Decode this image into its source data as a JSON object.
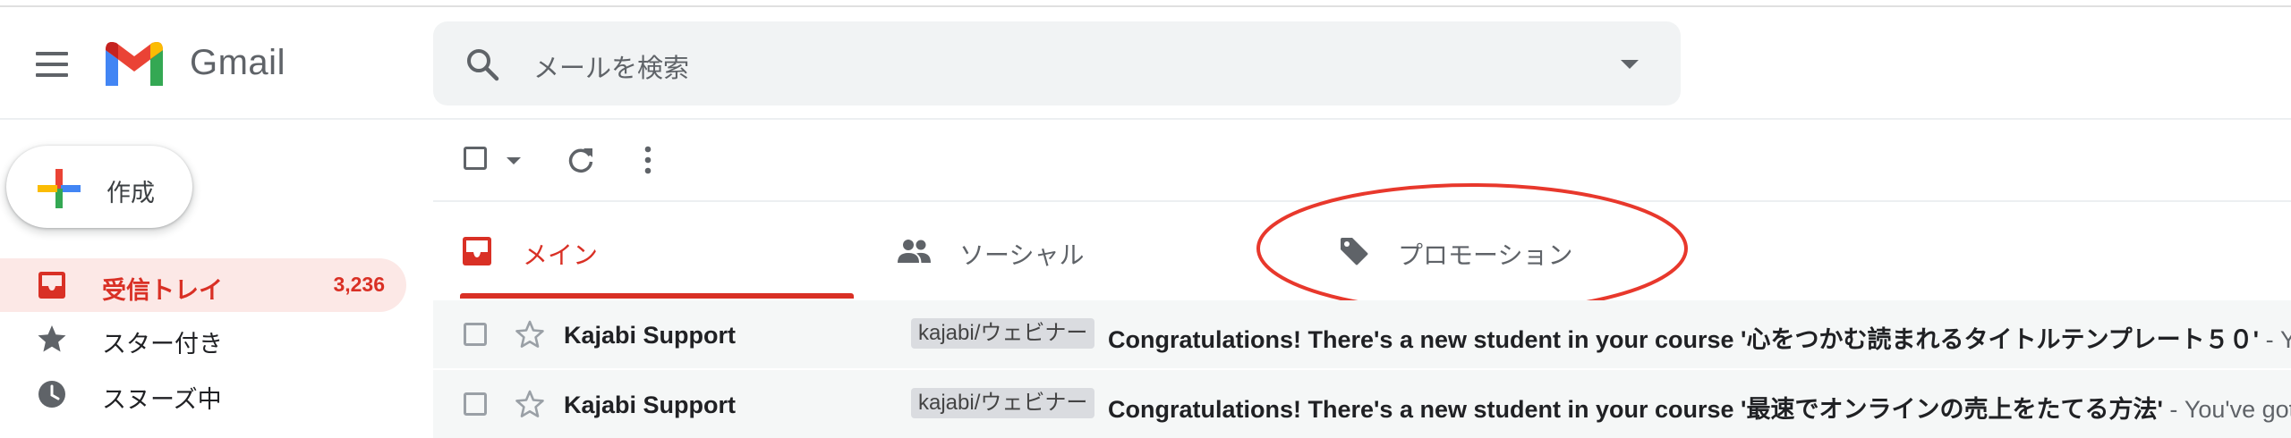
{
  "app": {
    "name": "Gmail"
  },
  "search": {
    "placeholder": "メールを検索"
  },
  "compose": {
    "label": "作成"
  },
  "sidebar": {
    "items": [
      {
        "label": "受信トレイ",
        "count": "3,236",
        "icon": "inbox-icon",
        "active": true
      },
      {
        "label": "スター付き",
        "icon": "star-icon"
      },
      {
        "label": "スヌーズ中",
        "icon": "clock-icon"
      }
    ]
  },
  "toolbar": {
    "icons": [
      "select-all-checkbox",
      "refresh-icon",
      "more-vert-icon"
    ]
  },
  "tabs": [
    {
      "label": "メイン",
      "icon": "inbox-icon",
      "active": true
    },
    {
      "label": "ソーシャル",
      "icon": "people-icon"
    },
    {
      "label": "プロモーション",
      "icon": "tag-icon"
    }
  ],
  "emails": [
    {
      "sender": "Kajabi Support",
      "label": "kajabi/ウェビナー",
      "subject": "Congratulations! There's a new student in your course '心をつかむ読まれるタイトルテンプレート５０'",
      "snippet": " - You"
    },
    {
      "sender": "Kajabi Support",
      "label": "kajabi/ウェビナー",
      "subject": "Congratulations! There's a new student in your course '最速でオンラインの売上をたてる方法'",
      "snippet": " - You've got a"
    }
  ],
  "colors": {
    "accent": "#d93025",
    "active_bg": "#fce8e6",
    "search_bg": "#f1f3f4",
    "annotation": "#e8382c"
  }
}
